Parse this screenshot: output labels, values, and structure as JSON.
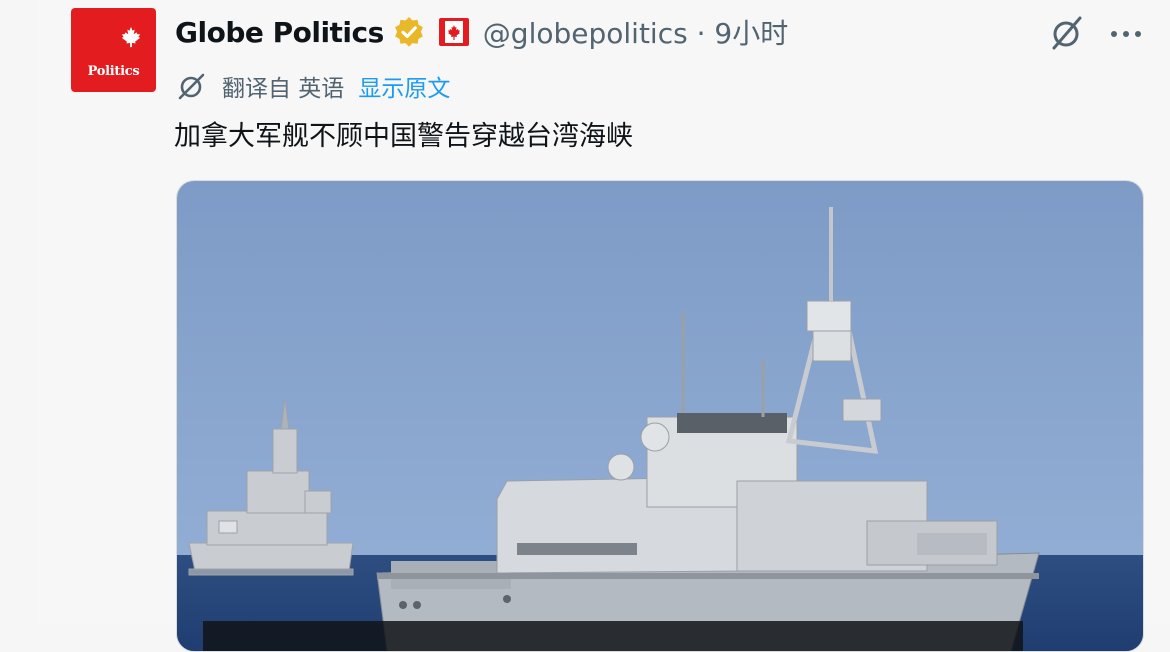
{
  "tweet": {
    "display_name": "Globe Politics",
    "handle": "@globepolitics",
    "separator": "·",
    "time": "9小时",
    "avatar_text": "Politics",
    "translate_label": "翻译自 英语",
    "show_original": "显示原文",
    "text": "加拿大军舰不顾中国警告穿越台湾海峡"
  },
  "icons": {
    "verified": "verified-badge-icon",
    "flag": "canada-flag-icon",
    "grok": "grok-icon",
    "more": "more-icon",
    "translate": "translate-icon"
  },
  "colors": {
    "brand_red": "#e31d1f",
    "link_blue": "#1d9bf0",
    "verified_gold": "#e8b828",
    "muted": "#536471"
  }
}
